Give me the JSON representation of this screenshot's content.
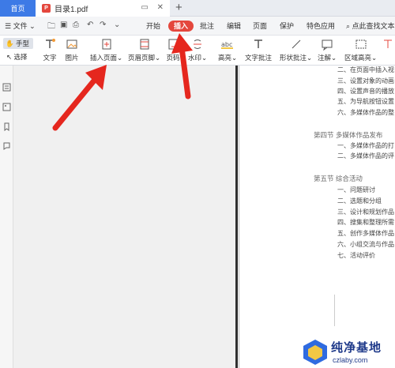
{
  "tabs": {
    "home": "首页",
    "doc_title": "目录1.pdf",
    "add": "+"
  },
  "menu": {
    "file": "文件",
    "start": "开始",
    "insert": "插入",
    "annotate": "批注",
    "edit": "编辑",
    "page": "页面",
    "protect": "保护",
    "special": "特色应用",
    "search": "点此查找文本"
  },
  "toolbar": {
    "hand": "手型",
    "select": "选择",
    "text": "文字",
    "image": "图片",
    "insert_page": "插入页面",
    "header_footer": "页眉页脚",
    "page_num": "页码",
    "watermark": "水印",
    "highlight": "高亮",
    "text_note": "文字批注",
    "shape_note": "形状批注",
    "annotation": "注解",
    "area_highlight": "区域高亮"
  },
  "document": {
    "lines": [
      "二、在页面中插入视",
      "三、设置对象的动画",
      "四、设置声音的播放",
      "五、为导航按钮设置",
      "六、多媒体作品的整"
    ],
    "section4": "第四节  多媒体作品发布",
    "section4_lines": [
      "一、多媒体作品的打",
      "二、多媒体作品的评"
    ],
    "section5": "第五节  综合活动",
    "section5_lines": [
      "一、问题研讨",
      "二、选题和分组",
      "三、设计和规划作品",
      "四、搜集和整理所需",
      "五、创作多媒体作品",
      "六、小组交流与作品",
      "七、活动评价"
    ]
  },
  "watermark": {
    "title": "纯净基地",
    "url": "czlaby.com"
  },
  "colors": {
    "accent": "#3d7ae6",
    "insert_active": "#e4473d",
    "arrow": "#e5271e"
  }
}
